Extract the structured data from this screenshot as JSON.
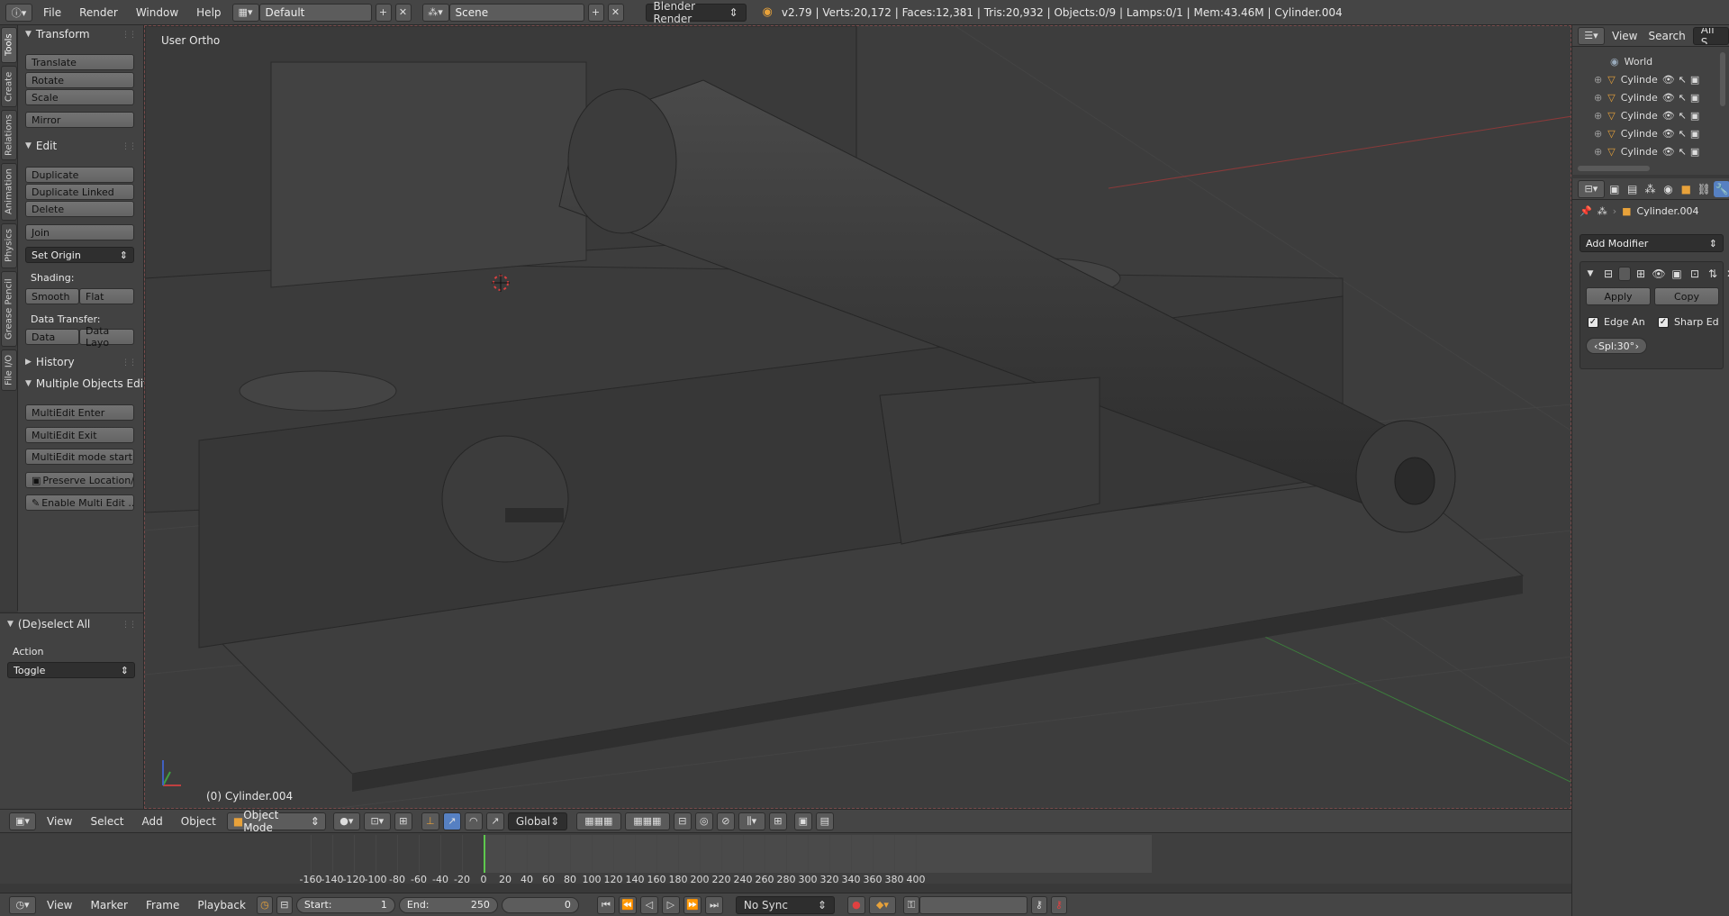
{
  "topbar": {
    "menus": [
      "File",
      "Render",
      "Window",
      "Help"
    ],
    "layout": "Default",
    "scene": "Scene",
    "engine": "Blender Render",
    "stats": "v2.79 | Verts:20,172 | Faces:12,381 | Tris:20,932 | Objects:0/9 | Lamps:0/1 | Mem:43.46M | Cylinder.004"
  },
  "tabs": [
    "Tools",
    "Create",
    "Relations",
    "Animation",
    "Physics",
    "Grease Pencil",
    "File I/O"
  ],
  "toolshelf": {
    "transform": {
      "title": "Transform",
      "buttons": [
        "Translate",
        "Rotate",
        "Scale",
        "Mirror"
      ]
    },
    "edit": {
      "title": "Edit",
      "buttons": [
        "Duplicate",
        "Duplicate Linked",
        "Delete",
        "Join"
      ],
      "set_origin": "Set Origin",
      "shading_label": "Shading:",
      "smooth": "Smooth",
      "flat": "Flat",
      "data_transfer_label": "Data Transfer:",
      "data": "Data",
      "data_layout": "Data Layo"
    },
    "history": {
      "title": "History"
    },
    "multi": {
      "title": "Multiple Objects Edit",
      "buttons": [
        "MultiEdit Enter",
        "MultiEdit Exit",
        "MultiEdit mode start",
        "Preserve Location/...",
        "Enable Multi Edit ..."
      ]
    },
    "operator": {
      "title": "(De)select All",
      "action_label": "Action",
      "action_value": "Toggle"
    }
  },
  "viewport": {
    "view_label": "User Ortho",
    "object_label": "(0) Cylinder.004"
  },
  "vpheader": {
    "menus": [
      "View",
      "Select",
      "Add",
      "Object"
    ],
    "mode": "Object Mode",
    "orientation": "Global"
  },
  "timeline": {
    "ticks": [
      "-160",
      "-140",
      "-120",
      "-100",
      "-80",
      "-60",
      "-40",
      "-20",
      "0",
      "20",
      "40",
      "60",
      "80",
      "100",
      "120",
      "140",
      "160",
      "180",
      "200",
      "220",
      "240",
      "260",
      "280",
      "300",
      "320",
      "340",
      "360",
      "380",
      "400"
    ],
    "current_frame_value": 0
  },
  "tlheader": {
    "menus": [
      "View",
      "Marker",
      "Frame",
      "Playback"
    ],
    "start_label": "Start:",
    "start_value": "1",
    "end_label": "End:",
    "end_value": "250",
    "current": "0",
    "sync": "No Sync"
  },
  "outliner": {
    "view": "View",
    "search": "Search",
    "filter": "All S",
    "rows": [
      "World",
      "Cylinde",
      "Cylinde",
      "Cylinde",
      "Cylinde",
      "Cylinde"
    ]
  },
  "properties": {
    "object_name": "Cylinder.004",
    "add_modifier": "Add Modifier",
    "apply": "Apply",
    "copy": "Copy",
    "edge_angle": "Edge An",
    "sharp_edges": "Sharp Ed",
    "split_angle": "Spl:30°"
  },
  "colors": {
    "accent_green": "#5ec84e",
    "orange_icon": "#e8a23a",
    "viewport_bg": "#3d3d3d"
  }
}
